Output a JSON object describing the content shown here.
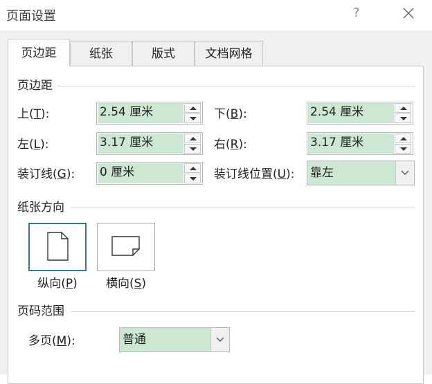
{
  "window": {
    "title": "页面设置",
    "help_glyph": "?",
    "close_glyph": "✕"
  },
  "tabs": [
    {
      "label": "页边距",
      "active": true
    },
    {
      "label": "纸张",
      "active": false
    },
    {
      "label": "版式",
      "active": false
    },
    {
      "label": "文档网格",
      "active": false
    }
  ],
  "margins": {
    "heading": "页边距",
    "top": {
      "label": "上",
      "key": "T",
      "suffix": "):",
      "value": "2.54 厘米"
    },
    "bottom": {
      "label": "下",
      "key": "B",
      "suffix": "):",
      "value": "2.54 厘米"
    },
    "left": {
      "label": "左",
      "key": "L",
      "suffix": "):",
      "value": "3.17 厘米"
    },
    "right": {
      "label": "右",
      "key": "R",
      "suffix": "):",
      "value": "3.17 厘米"
    },
    "gutter": {
      "label": "装订线",
      "key": "G",
      "suffix": "):",
      "value": "0 厘米"
    },
    "gutter_pos": {
      "label": "装订线位置",
      "key": "U",
      "suffix": "):",
      "value": "靠左"
    }
  },
  "orientation": {
    "heading": "纸张方向",
    "portrait": {
      "label": "纵向",
      "key": "P",
      "selected": true
    },
    "landscape": {
      "label": "横向",
      "key": "S",
      "selected": false
    }
  },
  "pages": {
    "heading": "页码范围",
    "multi": {
      "label": "多页",
      "key": "M",
      "suffix": "):",
      "value": "普通"
    }
  },
  "colors": {
    "field_bg": "#cde8d2",
    "selected_border": "#2f7d8c"
  }
}
